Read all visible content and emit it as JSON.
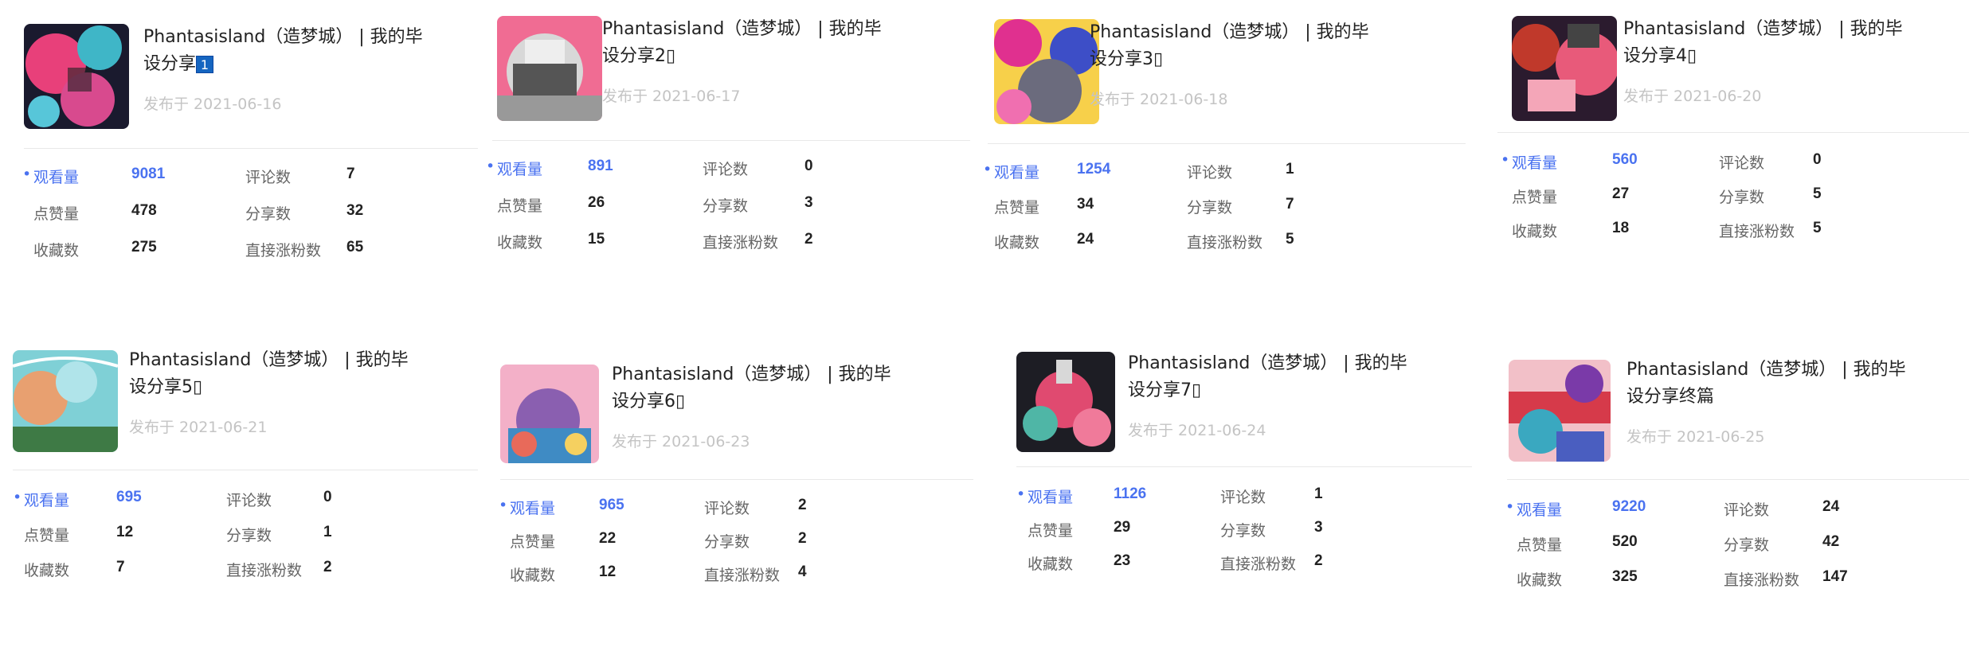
{
  "labels": {
    "views": "观看量",
    "comments": "评论数",
    "likes": "点赞量",
    "shares": "分享数",
    "favorites": "收藏数",
    "new_followers": "直接涨粉数",
    "published_prefix": "发布于"
  },
  "accent_color": "#4a72f0",
  "cards": [
    {
      "title_line1": "Phantasisland（造梦城） | 我的毕",
      "title_line2": "设分享",
      "badge": "1",
      "date": "发布于 2021-06-16",
      "stats": {
        "views": "9081",
        "comments": "7",
        "likes": "478",
        "shares": "32",
        "favorites": "275",
        "new_followers": "65"
      }
    },
    {
      "title_line1": "Phantasisland（造梦城） | 我的毕",
      "title_line2": "设分享2▯",
      "date": "发布于 2021-06-17",
      "stats": {
        "views": "891",
        "comments": "0",
        "likes": "26",
        "shares": "3",
        "favorites": "15",
        "new_followers": "2"
      }
    },
    {
      "title_line1": "Phantasisland（造梦城） | 我的毕",
      "title_line2": "设分享3▯",
      "date": "发布于 2021-06-18",
      "stats": {
        "views": "1254",
        "comments": "1",
        "likes": "34",
        "shares": "7",
        "favorites": "24",
        "new_followers": "5"
      }
    },
    {
      "title_line1": "Phantasisland（造梦城） | 我的毕",
      "title_line2": "设分享4▯",
      "date": "发布于 2021-06-20",
      "stats": {
        "views": "560",
        "comments": "0",
        "likes": "27",
        "shares": "5",
        "favorites": "18",
        "new_followers": "5"
      }
    },
    {
      "title_line1": "Phantasisland（造梦城） | 我的毕",
      "title_line2": "设分享5▯",
      "date": "发布于 2021-06-21",
      "stats": {
        "views": "695",
        "comments": "0",
        "likes": "12",
        "shares": "1",
        "favorites": "7",
        "new_followers": "2"
      }
    },
    {
      "title_line1": "Phantasisland（造梦城） | 我的毕",
      "title_line2": "设分享6▯",
      "date": "发布于 2021-06-23",
      "stats": {
        "views": "965",
        "comments": "2",
        "likes": "22",
        "shares": "2",
        "favorites": "12",
        "new_followers": "4"
      }
    },
    {
      "title_line1": "Phantasisland（造梦城） | 我的毕",
      "title_line2": "设分享7▯",
      "date": "发布于 2021-06-24",
      "stats": {
        "views": "1126",
        "comments": "1",
        "likes": "29",
        "shares": "3",
        "favorites": "23",
        "new_followers": "2"
      }
    },
    {
      "title_line1": "Phantasisland（造梦城） | 我的毕",
      "title_line2": "设分享终篇",
      "date": "发布于 2021-06-25",
      "stats": {
        "views": "9220",
        "comments": "24",
        "likes": "520",
        "shares": "42",
        "favorites": "325",
        "new_followers": "147"
      }
    }
  ]
}
